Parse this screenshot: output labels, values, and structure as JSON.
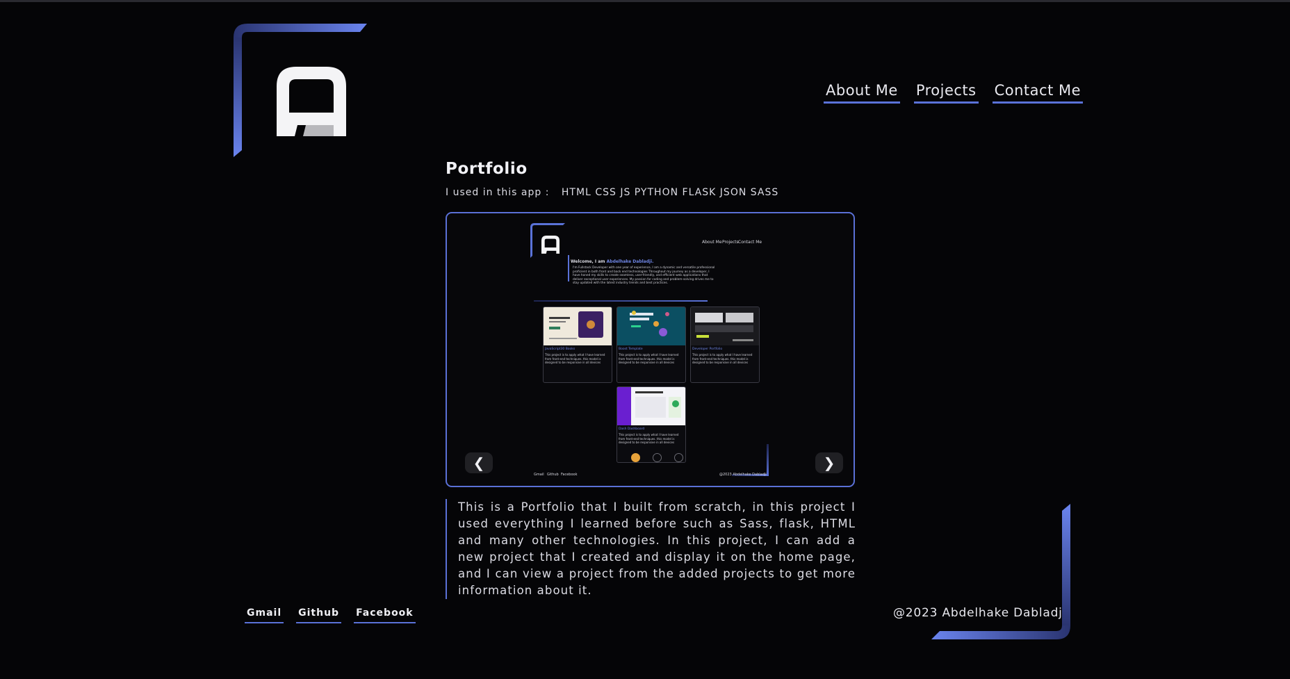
{
  "nav": {
    "about": "About Me",
    "projects": "Projects",
    "contact": "Contact Me"
  },
  "project": {
    "title": "Portfolio",
    "used_label": "I used in this app :",
    "technologies": [
      "HTML",
      "CSS",
      "JS",
      "PYTHON",
      "FLASK",
      "JSON",
      "SASS"
    ],
    "description": "This is a Portfolio that I built from scratch, in this project I used everything I learned before such as Sass, flask, HTML and many other technologies. In this project, I can add a new project that I created and display it on the home page, and I can view a project from the added projects to get more information about it."
  },
  "carousel": {
    "prev": "❮",
    "next": "❯",
    "active_slide": 1,
    "total_slides": 3
  },
  "preview": {
    "nav": {
      "about": "About Me",
      "projects": "Projects",
      "contact": "Contact Me"
    },
    "welcome_prefix": "Welcome, I am",
    "welcome_name": "Abdelhake Dabladji.",
    "intro": "I'm Fullstack Developer with one year of experience, I am a dynamic and versatile professional proficient in both front and back end technologies Throughout my journey as a developer, I have honed my skills to create seamless, user-friendly, and efficient web applications that deliver exceptional user experiences. My passion for coding and problem-solving drives me to stay updated with the latest industry trends and best practices.",
    "cards": [
      {
        "title": "JavaScript30 Books",
        "desc": "This project is to apply what I have learned from front-end techniques. this model is designed to be responsive in all devices"
      },
      {
        "title": "Boost Template",
        "desc": "This project is to apply what I have learned from front-end techniques. this model is designed to be responsive in all devices"
      },
      {
        "title": "Developer Portfolio",
        "desc": "This project is to apply what I have learned from front-end techniques. this model is designed to be responsive in all devices"
      },
      {
        "title": "Dash Dashboard",
        "desc": "This project is to apply what I have learned from front-end techniques. this model is designed to be responsive in all devices"
      }
    ],
    "footer_links": [
      "Gmail",
      "Github",
      "Facebook"
    ],
    "copyright": "@2023 Abdelhake Dabladji"
  },
  "footer": {
    "gmail": "Gmail",
    "github": "Github",
    "facebook": "Facebook",
    "copyright": "@2023 Abdelhake Dabladji"
  },
  "colors": {
    "accent": "#5a72d8",
    "background": "#050507",
    "highlight_name": "#6f86e6",
    "dot_active": "#e8a33a"
  }
}
